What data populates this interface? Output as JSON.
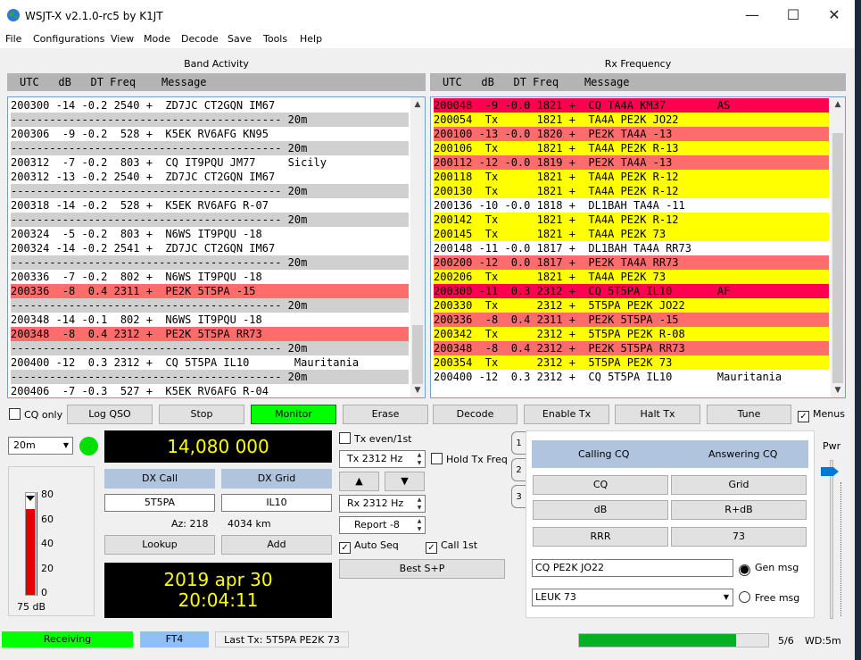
{
  "title": "WSJT-X   v2.1.0-rc5   by K1JT",
  "menu": [
    "File",
    "Configurations",
    "View",
    "Mode",
    "Decode",
    "Save",
    "Tools",
    "Help"
  ],
  "band_activity": {
    "title": "Band Activity",
    "header": "UTC   dB   DT Freq    Message",
    "rows": [
      {
        "t": "200300 -14 -0.2 2540 +  ZD7JC CT2GQN IM67",
        "s": "n"
      },
      {
        "t": "------------------------------------------ 20m",
        "s": "sep"
      },
      {
        "t": "200306  -9 -0.2  528 +  K5EK RV6AFG KN95",
        "s": "n"
      },
      {
        "t": "------------------------------------------ 20m",
        "s": "sep"
      },
      {
        "t": "200312  -7 -0.2  803 +  CQ IT9PQU JM77     Sicily",
        "s": "n"
      },
      {
        "t": "200312 -13 -0.2 2540 +  ZD7JC CT2GQN IM67",
        "s": "n"
      },
      {
        "t": "------------------------------------------ 20m",
        "s": "sep"
      },
      {
        "t": "200318 -14 -0.2  528 +  K5EK RV6AFG R-07",
        "s": "n"
      },
      {
        "t": "------------------------------------------ 20m",
        "s": "sep"
      },
      {
        "t": "200324  -5 -0.2  803 +  N6WS IT9PQU -18",
        "s": "n"
      },
      {
        "t": "200324 -14 -0.2 2541 +  ZD7JC CT2GQN IM67",
        "s": "n"
      },
      {
        "t": "------------------------------------------ 20m",
        "s": "sep"
      },
      {
        "t": "200336  -7 -0.2  802 +  N6WS IT9PQU -18",
        "s": "n"
      },
      {
        "t": "200336  -8  0.4 2311 +  PE2K 5T5PA -15",
        "s": "red"
      },
      {
        "t": "------------------------------------------ 20m",
        "s": "sep"
      },
      {
        "t": "200348 -14 -0.1  802 +  N6WS IT9PQU -18",
        "s": "n"
      },
      {
        "t": "200348  -8  0.4 2312 +  PE2K 5T5PA RR73",
        "s": "red"
      },
      {
        "t": "------------------------------------------ 20m",
        "s": "sep"
      },
      {
        "t": "200400 -12  0.3 2312 +  CQ 5T5PA IL10       Mauritania",
        "s": "n"
      },
      {
        "t": "------------------------------------------ 20m",
        "s": "sep"
      },
      {
        "t": "200406  -7 -0.3  527 +  K5EK RV6AFG R-04",
        "s": "n"
      }
    ]
  },
  "rx_frequency": {
    "title": "Rx Frequency",
    "header": "UTC   dB   DT Freq    Message",
    "rows": [
      {
        "t": "200048  -9 -0.0 1821 +  CQ TA4A KM37        AS",
        "s": "mag"
      },
      {
        "t": "200054  Tx      1821 +  TA4A PE2K JO22",
        "s": "yel"
      },
      {
        "t": "200100 -13 -0.0 1820 +  PE2K TA4A -13",
        "s": "red"
      },
      {
        "t": "200106  Tx      1821 +  TA4A PE2K R-13",
        "s": "yel"
      },
      {
        "t": "200112 -12 -0.0 1819 +  PE2K TA4A -13",
        "s": "red"
      },
      {
        "t": "200118  Tx      1821 +  TA4A PE2K R-12",
        "s": "yel"
      },
      {
        "t": "200130  Tx      1821 +  TA4A PE2K R-12",
        "s": "yel"
      },
      {
        "t": "200136 -10 -0.0 1818 +  DL1BAH TA4A -11",
        "s": "n"
      },
      {
        "t": "200142  Tx      1821 +  TA4A PE2K R-12",
        "s": "yel"
      },
      {
        "t": "200145  Tx      1821 +  TA4A PE2K 73",
        "s": "yel"
      },
      {
        "t": "200148 -11 -0.0 1817 +  DL1BAH TA4A RR73",
        "s": "n"
      },
      {
        "t": "200200 -12  0.0 1817 +  PE2K TA4A RR73",
        "s": "red"
      },
      {
        "t": "200206  Tx      1821 +  TA4A PE2K 73",
        "s": "yel"
      },
      {
        "t": "200300 -11  0.3 2312 +  CQ 5T5PA IL10       AF",
        "s": "mag"
      },
      {
        "t": "200330  Tx      2312 +  5T5PA PE2K JO22",
        "s": "yel"
      },
      {
        "t": "200336  -8  0.4 2311 +  PE2K 5T5PA -15",
        "s": "red"
      },
      {
        "t": "200342  Tx      2312 +  5T5PA PE2K R-08",
        "s": "yel"
      },
      {
        "t": "200348  -8  0.4 2312 +  PE2K 5T5PA RR73",
        "s": "red"
      },
      {
        "t": "200354  Tx      2312 +  5T5PA PE2K 73",
        "s": "yel"
      },
      {
        "t": "200400 -12  0.3 2312 +  CQ 5T5PA IL10       Mauritania",
        "s": "n"
      }
    ]
  },
  "controls": {
    "cq_only": "CQ only",
    "log_qso": "Log QSO",
    "stop": "Stop",
    "monitor": "Monitor",
    "erase": "Erase",
    "decode": "Decode",
    "enable_tx": "Enable Tx",
    "halt_tx": "Halt Tx",
    "tune": "Tune",
    "menus": "Menus"
  },
  "left": {
    "band": "20m",
    "meter_ticks": [
      "80",
      "60",
      "40",
      "20",
      "0"
    ],
    "meter_db": "75 dB",
    "meter_level": 0.84,
    "frequency": "14,080 000",
    "dx_call_label": "DX Call",
    "dx_grid_label": "DX Grid",
    "dx_call": "5T5PA",
    "dx_grid": "IL10",
    "az": "Az: 218",
    "distance": "4034 km",
    "lookup": "Lookup",
    "add": "Add",
    "date": "2019 apr 30",
    "time": "20:04:11"
  },
  "mid": {
    "tx_even": "Tx even/1st",
    "tx_freq": "Tx  2312  Hz",
    "hold_tx": "Hold Tx Freq",
    "up": "▲",
    "down": "▼",
    "rx_freq": "Rx  2312  Hz",
    "report": "Report -8",
    "auto_seq": "Auto Seq",
    "call_1st": "Call 1st",
    "best_sp": "Best S+P"
  },
  "tabs": [
    "1",
    "2",
    "3"
  ],
  "msg_panel": {
    "calling_cq": "Calling CQ",
    "answering_cq": "Answering CQ",
    "buttons": [
      [
        "CQ",
        "Grid"
      ],
      [
        "dB",
        "R+dB"
      ],
      [
        "RRR",
        "73"
      ]
    ],
    "gen_msg_text": "CQ PE2K JO22",
    "gen_msg": "Gen msg",
    "free_msg_text": "LEUK 73",
    "free_msg": "Free msg"
  },
  "pwr": "Pwr",
  "statusbar": {
    "receiving": "Receiving",
    "mode": "FT4",
    "last_tx": "Last Tx: 5T5PA PE2K 73",
    "progress": 0.83,
    "period": "5/6",
    "wd": "WD:5m"
  },
  "colors": {
    "green": "#00ff00",
    "red_row": "#ff6c6c",
    "yellow_row": "#ffff00",
    "magenta_row": "#ff0050",
    "blue_btn": "#b0c4de"
  }
}
